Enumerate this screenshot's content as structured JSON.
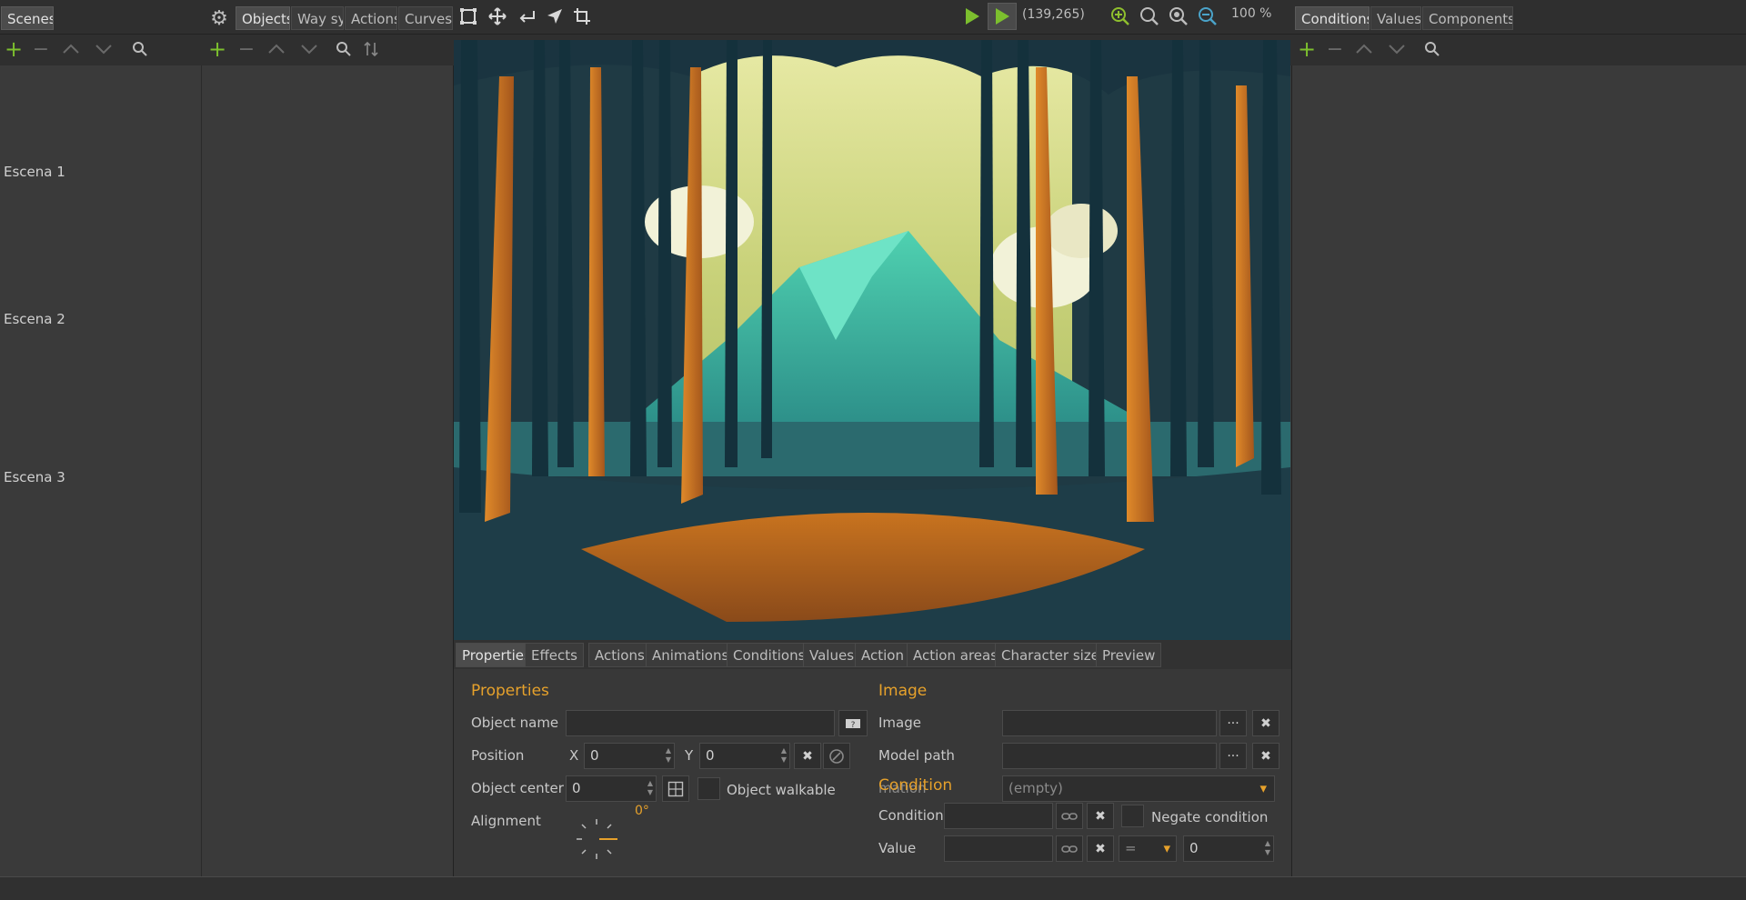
{
  "topbar": {
    "left_tab": "Scenes",
    "object_tabs": [
      "Objects",
      "Way sys",
      "Actions",
      "Curves"
    ],
    "coords": "(139,265)",
    "zoom": "100 %",
    "right_tabs": [
      "Conditions",
      "Values",
      "Components"
    ]
  },
  "scenes": {
    "items": [
      "Escena 1",
      "Escena 2",
      "Escena 3"
    ]
  },
  "bottom_tabs": [
    "Properties",
    "Effects",
    "Actions",
    "Animations",
    "Conditions",
    "Values",
    "Action",
    "Action areas",
    "Character size",
    "Preview"
  ],
  "properties": {
    "title": "Properties",
    "object_name_label": "Object name",
    "object_name_value": "",
    "position_label": "Position",
    "x_label": "X",
    "x_value": "0",
    "y_label": "Y",
    "y_value": "0",
    "object_center_label": "Object center",
    "object_center_value": "0",
    "object_walkable_label": "Object walkable",
    "alignment_label": "Alignment",
    "alignment_angle": "0°"
  },
  "image": {
    "title": "Image",
    "image_label": "Image",
    "model_path_label": "Model path",
    "animation_label_partial": "mation",
    "animation_value": "(empty)"
  },
  "condition": {
    "title": "Condition",
    "condition_label": "Condition",
    "negate_label": "Negate condition",
    "value_label": "Value",
    "operator_value": "=",
    "value_number": "0"
  },
  "colors": {
    "accent": "#e6a12b",
    "green": "#7cbf2e",
    "background": "#3a3a3a"
  }
}
